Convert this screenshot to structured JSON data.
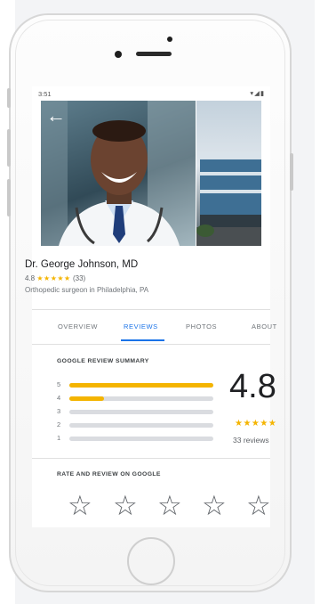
{
  "status_bar": {
    "time": "3:51",
    "icons": "▾◢▮"
  },
  "header": {
    "back_icon": "arrow-left-icon"
  },
  "profile": {
    "name": "Dr. George Johnson, MD",
    "rating": "4.8",
    "stars": "★★★★★",
    "review_count_short": "(33)",
    "specialty": "Orthopedic surgeon in Philadelphia, PA"
  },
  "tabs": [
    {
      "label": "OVERVIEW",
      "active": false
    },
    {
      "label": "REVIEWS",
      "active": true
    },
    {
      "label": "PHOTOS",
      "active": false
    },
    {
      "label": "ABOUT",
      "active": false
    }
  ],
  "review_summary": {
    "title": "GOOGLE REVIEW SUMMARY",
    "histogram": [
      {
        "star": "5",
        "fraction": 1.0
      },
      {
        "star": "4",
        "fraction": 0.24
      },
      {
        "star": "3",
        "fraction": 0.0
      },
      {
        "star": "2",
        "fraction": 0.0
      },
      {
        "star": "1",
        "fraction": 0.0
      }
    ],
    "average": "4.8",
    "stars": "★★★★★",
    "reviews_label": "33 reviews"
  },
  "rate_section": {
    "title": "RATE AND REVIEW ON GOOGLE",
    "star_glyph": "☆",
    "star_count": 5
  },
  "colors": {
    "accent": "#1a73e8",
    "star_gold": "#f4b400",
    "bar_track": "#dadce0"
  }
}
